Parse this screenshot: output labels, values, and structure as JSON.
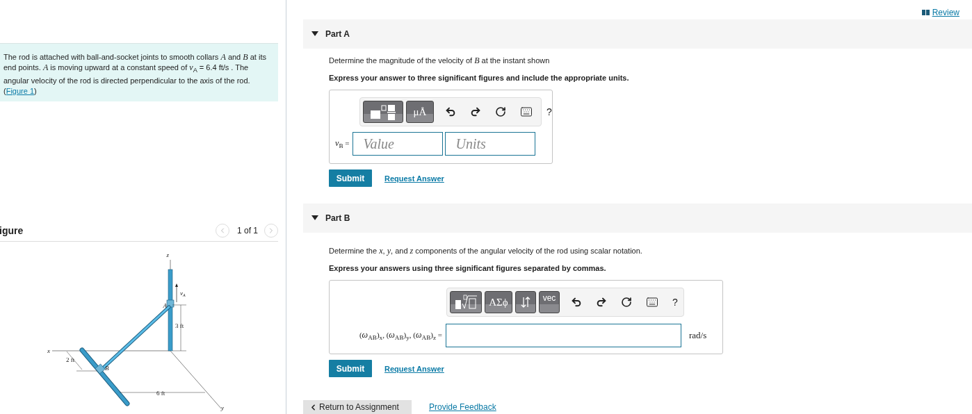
{
  "review_link": "Review",
  "problem": {
    "text": "The rod is attached with ball-and-socket joints to smooth collars *A* and *B* at its end points. *A* is moving upward at a constant speed of *v*$_{A}$ = 6.4  ft/s . The angular velocity of the rod is directed perpendicular to the axis of the rod. (",
    "link": "Figure 1",
    "after": ")"
  },
  "figure": {
    "title": "igure",
    "pager": "1 of 1",
    "labels": [
      {
        "kind": "axis",
        "text": "z"
      },
      {
        "kind": "velocity",
        "text": "v",
        "sub": "A"
      },
      {
        "kind": "point-a",
        "text": "A"
      },
      {
        "kind": "dim-3",
        "text": "3 ft"
      },
      {
        "kind": "axis-x",
        "text": "x"
      },
      {
        "kind": "dim-2",
        "text": "2 ft"
      },
      {
        "kind": "point-b",
        "text": "B"
      },
      {
        "kind": "dim-6",
        "text": "6 ft"
      },
      {
        "kind": "axis-y",
        "text": "y"
      }
    ]
  },
  "parts": [
    {
      "title": "Part A",
      "expanded": true,
      "question": "Determine the magnitude of the velocity of *B* at the instant shown",
      "instruction": "Express your answer to three significant figures and include the appropriate units.",
      "kind": "value-units",
      "tools": [
        {
          "kind": "templates"
        },
        {
          "kind": "text",
          "text": "μÅ"
        }
      ],
      "label": "*v*$_{B}$ =",
      "placeholders": [
        "Value",
        "Units"
      ],
      "help": "?",
      "submit": "Submit",
      "request": "Request Answer"
    },
    {
      "title": "Part B",
      "expanded": true,
      "question": "Determine the *x*, *y*, and *z* components of the angular velocity of the rod using scalar notation.",
      "instruction": "Express your answers using three significant figures separated by commas.",
      "kind": "single",
      "tools": [
        {
          "kind": "radical"
        },
        {
          "kind": "text",
          "text": "ΑΣϕ"
        },
        {
          "kind": "arrows"
        },
        {
          "kind": "small-text",
          "text": "vec"
        }
      ],
      "label": "(*ω*$_{AB}$)$_{x}$, (*ω*$_{AB}$)$_{y}$, (*ω*$_{AB}$)$_{z}$ =",
      "unit": "rad/s",
      "help": "?",
      "submit": "Submit",
      "request": "Request Answer"
    }
  ],
  "footer": {
    "back": "Return to Assignment",
    "feedback": "Provide Feedback"
  }
}
